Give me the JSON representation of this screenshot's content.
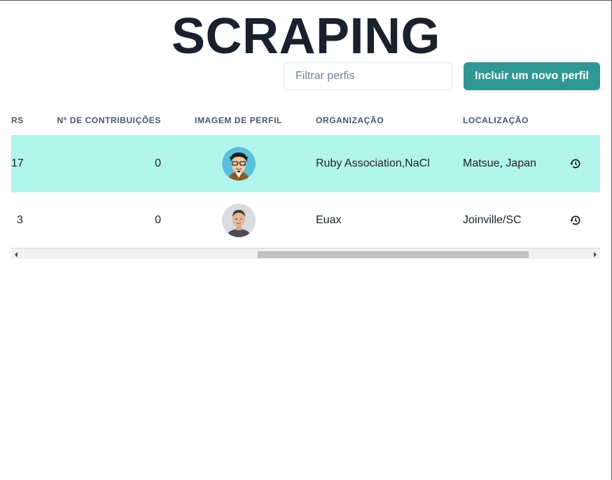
{
  "page": {
    "title": "SCRAPING"
  },
  "search": {
    "placeholder": "Filtrar perfis",
    "value": ""
  },
  "actions": {
    "add_profile_label": "Incluir um novo perfil"
  },
  "colors": {
    "accent": "#319795",
    "highlight_row": "#b2f5ea",
    "title": "#1a202c"
  },
  "table": {
    "headers": {
      "followers_partial": "RS",
      "contributions": "Nº DE CONTRIBUIÇÕES",
      "profile_image": "IMAGEM DE PERFIL",
      "organization": "ORGANIZAÇÃO",
      "location": "LOCALIZAÇÃO"
    },
    "rows": [
      {
        "followers": "17",
        "contributions": "0",
        "avatar": "cartoon-avatar",
        "organization": "Ruby Association,NaCl",
        "location": "Matsue, Japan",
        "action_icon": "history-icon",
        "highlighted": true
      },
      {
        "followers": "3",
        "contributions": "0",
        "avatar": "photo-avatar",
        "organization": "Euax",
        "location": "Joinville/SC",
        "action_icon": "history-icon",
        "highlighted": false
      }
    ]
  },
  "scroll": {
    "horizontal_position_fraction": 0.42
  }
}
